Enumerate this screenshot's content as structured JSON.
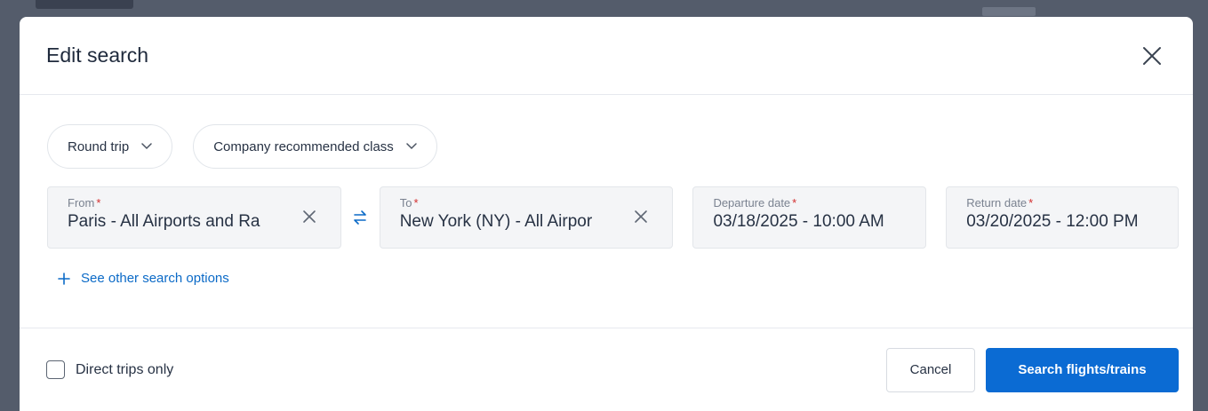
{
  "modal": {
    "title": "Edit search",
    "close_icon": "close-icon"
  },
  "options": {
    "trip_type": "Round trip",
    "cabin_class": "Company recommended class"
  },
  "fields": {
    "from": {
      "label": "From",
      "required_mark": "*",
      "value": "Paris - All Airports and Ra"
    },
    "to": {
      "label": "To",
      "required_mark": "*",
      "value": "New York (NY) - All Airpor"
    },
    "departure": {
      "label": "Departure date",
      "required_mark": "*",
      "value": "03/18/2025 - 10:00 AM"
    },
    "return": {
      "label": "Return date",
      "required_mark": "*",
      "value": "03/20/2025 - 12:00 PM"
    }
  },
  "other_options_label": "See other search options",
  "footer": {
    "direct_only_label": "Direct trips only",
    "cancel_label": "Cancel",
    "search_label": "Search flights/trains"
  },
  "colors": {
    "accent": "#0b6bd3",
    "link": "#0b6ac7",
    "required": "#d32f2f"
  }
}
